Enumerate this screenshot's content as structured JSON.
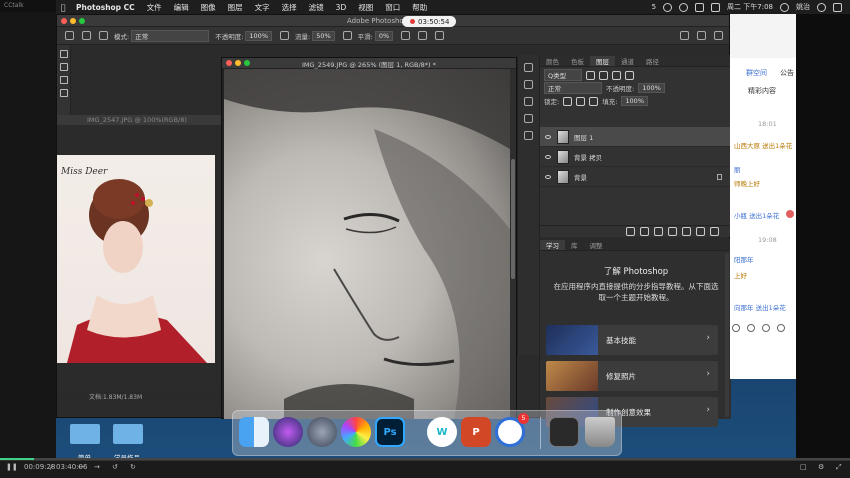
{
  "cctalk": {
    "label": "CCtalk",
    "player": {
      "elapsed": "00:09:28",
      "separator": "/",
      "total": "03:40:06",
      "progress_fraction": 0.04
    }
  },
  "menubar": {
    "app_name": "Photoshop CC",
    "items": [
      "文件",
      "编辑",
      "图像",
      "图层",
      "文字",
      "选择",
      "滤镜",
      "3D",
      "视图",
      "窗口",
      "帮助"
    ],
    "status_badge": "5",
    "datetime": "周二 下午7:08",
    "user": "姚治"
  },
  "ps_window": {
    "title": "Adobe Photoshop",
    "recording_time": "03:50:54",
    "options": {
      "mode_label": "模式:",
      "mode_value": "正常",
      "opacity_label": "不透明度:",
      "opacity_value": "100%",
      "flow_label": "流量:",
      "flow_value": "50%",
      "smooth_label": "平滑:",
      "smooth_value": "0%"
    }
  },
  "doc_background": {
    "title": "IMG_2547.JPG @ 100%(RGB/8)",
    "script_text": "Miss Deer",
    "status": "文档:1.83M/1.83M",
    "zoom": "100%"
  },
  "doc_main": {
    "title": "IMG_2549.JPG @ 265% (图层 1, RGB/8*) *"
  },
  "layers_panel": {
    "tabs": [
      "颜色",
      "色板",
      "图层",
      "通道",
      "路径"
    ],
    "active_tab": "图层",
    "kind_label": "Q类型",
    "blend_mode": "正常",
    "opacity_label": "不透明度:",
    "opacity_value": "100%",
    "lock_label": "锁定:",
    "fill_label": "填充:",
    "fill_value": "100%",
    "layers": [
      {
        "name": "图层 1",
        "selected": true,
        "locked": false
      },
      {
        "name": "背景 拷贝",
        "selected": false,
        "locked": false
      },
      {
        "name": "背景",
        "selected": false,
        "locked": true
      }
    ]
  },
  "learn_panel": {
    "tabs": [
      "学习",
      "库",
      "调整"
    ],
    "active_tab": "学习",
    "title": "了解 Photoshop",
    "description": "在应用程序内直接提供的分步指导教程。从下面选取一个主题开始教程。",
    "cards": [
      {
        "label": "基本技能",
        "color": "#2a3f6e"
      },
      {
        "label": "修复照片",
        "color": "#a06a3a"
      },
      {
        "label": "制作创意效果",
        "color": "#5a3f3a"
      }
    ]
  },
  "chat": {
    "tabs": [
      "群空间",
      "公告",
      "精彩内容"
    ],
    "messages": [
      {
        "text": "18:01",
        "kind": "time"
      },
      {
        "text": "山西大原 送出1朵花",
        "kind": "gold"
      },
      {
        "text": "丽",
        "kind": "blue"
      },
      {
        "text": "师晚上好",
        "kind": "gold"
      },
      {
        "text": "小瓶 送出1朵花",
        "kind": "blue"
      },
      {
        "text": "19:08",
        "kind": "time"
      },
      {
        "text": "阳那年",
        "kind": "blue"
      },
      {
        "text": "上好",
        "kind": "gold"
      },
      {
        "text": "向那年 送出1朵花",
        "kind": "blue"
      }
    ]
  },
  "desktop": {
    "icons": [
      {
        "label": "简单"
      },
      {
        "label": "学员作品"
      }
    ]
  },
  "dock": {
    "ps_label": "Ps",
    "badge": "5"
  },
  "colors": {
    "accent_green": "#3fd38a",
    "record_red": "#e23b3b",
    "chat_blue": "#3b6fd1",
    "chat_gold": "#b87800"
  }
}
